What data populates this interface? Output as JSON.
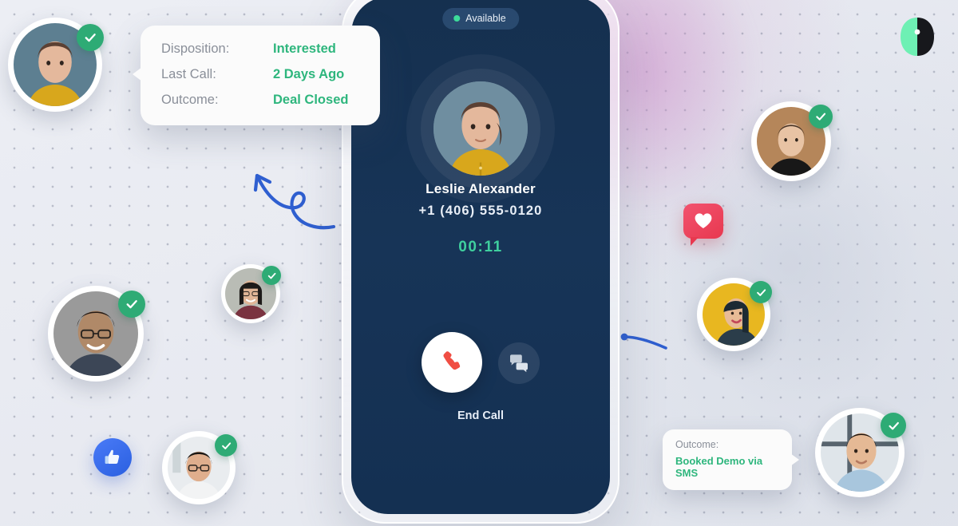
{
  "brand": {
    "logo_name": "brand-logo",
    "logo_colors": {
      "light": "#6ef0b4",
      "dark": "#17181c"
    }
  },
  "colors": {
    "accent_green": "#2eb67d",
    "timer_green": "#3fcf9e",
    "phone_navy": "#173457",
    "like_blue": "#2a5fe0",
    "heart_red": "#e8384f",
    "arrow_blue": "#2f5fd0"
  },
  "phone": {
    "status_badge": {
      "label": "Available",
      "dot_color": "#3ddc9a"
    },
    "callee_name": "Leslie Alexander",
    "callee_phone": "+1 (406) 555-0120",
    "call_timer": "00:11",
    "end_call_label": "End Call",
    "buttons": {
      "end_call_icon": "phone-hangup-icon",
      "chat_icon": "chat-bubbles-icon"
    }
  },
  "info_card": {
    "rows": [
      {
        "label": "Disposition:",
        "value": "Interested"
      },
      {
        "label": "Last Call:",
        "value": "2 Days Ago"
      },
      {
        "label": "Outcome:",
        "value": "Deal Closed"
      }
    ]
  },
  "outcome_card": {
    "label": "Outcome:",
    "value": "Booked Demo via SMS"
  },
  "reactions": [
    {
      "name": "heart-reaction-badge",
      "icon": "heart-icon"
    },
    {
      "name": "like-reaction-badge",
      "icon": "thumbs-up-icon"
    }
  ],
  "contacts": [
    {
      "name": "contact-avatar-1",
      "verified": true,
      "bg": "#5d7f91",
      "hair": "#5b4033",
      "shirt": "#d8a71c",
      "skin": "#e4b89c"
    },
    {
      "name": "contact-avatar-2",
      "verified": true,
      "bg": "#9a9a9a",
      "hair": "#241a15",
      "shirt": "#3c4656",
      "skin": "#b08968"
    },
    {
      "name": "contact-avatar-3",
      "verified": true,
      "bg": "#b9bcb5",
      "hair": "#1d1a18",
      "shirt": "#7a3340",
      "skin": "#e0b596"
    },
    {
      "name": "contact-avatar-4",
      "verified": true,
      "bg": "#e9ecef",
      "hair": "#1b1714",
      "shirt": "#f2f3f4",
      "skin": "#dfae8d"
    },
    {
      "name": "contact-avatar-5",
      "verified": true,
      "bg": "#b5865a",
      "hair": "#4a3526",
      "shirt": "#181818",
      "skin": "#e8c3a4"
    },
    {
      "name": "contact-avatar-6",
      "verified": true,
      "bg": "#e8b720",
      "hair": "#1d2a33",
      "shirt": "#2b3d4a",
      "skin": "#e8bb96"
    },
    {
      "name": "contact-avatar-7",
      "verified": true,
      "bg": "#dfe5ea",
      "hair": "#20160f",
      "shirt": "#a8c6dd",
      "skin": "#e5b995"
    }
  ],
  "annotations": [
    {
      "name": "curly-arrow-up-left",
      "icon": "arrow-icon"
    },
    {
      "name": "curve-stroke-right",
      "icon": "arrow-icon"
    }
  ]
}
